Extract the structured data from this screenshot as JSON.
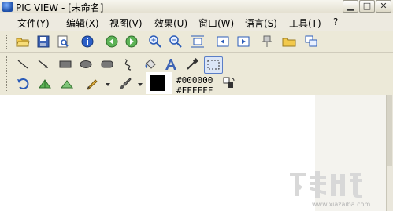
{
  "window": {
    "title": "PIC VIEW - [未命名]",
    "min_glyph": "▁",
    "max_glyph": "□",
    "close_glyph": "✕"
  },
  "menu": {
    "items": [
      {
        "label": "文件(Y)"
      },
      {
        "label": "编辑(X)"
      },
      {
        "label": "视图(V)"
      },
      {
        "label": "效果(U)"
      },
      {
        "label": "窗口(W)"
      },
      {
        "label": "语言(S)"
      },
      {
        "label": "工具(T)"
      },
      {
        "label": "?"
      }
    ]
  },
  "toolbar_main": {
    "icons": [
      "open-folder-icon",
      "save-icon",
      "print-preview-icon",
      "info-icon",
      "previous-icon",
      "next-icon",
      "zoom-in-icon",
      "zoom-out-icon",
      "fit-window-icon",
      "page-back-icon",
      "page-forward-icon",
      "pin-icon",
      "folder-icon",
      "copy-windows-icon"
    ]
  },
  "toolbar_draw": {
    "row1_icons": [
      "line-icon",
      "arrow-icon",
      "rectangle-icon",
      "ellipse-icon",
      "rounded-rect-icon",
      "freehand-icon",
      "fill-icon",
      "text-icon",
      "eyedropper-icon",
      "selection-rect-icon"
    ],
    "row2_icons": [
      "undo-icon",
      "sharpen-icon",
      "blur-icon",
      "pencil-icon",
      "brush-icon"
    ]
  },
  "colors": {
    "foreground": "#000000",
    "background": "#FFFFFF",
    "accent": "#5A7EC7"
  },
  "watermark": {
    "logo_text": "下载吧",
    "url": "www.xiazaiba.com"
  }
}
